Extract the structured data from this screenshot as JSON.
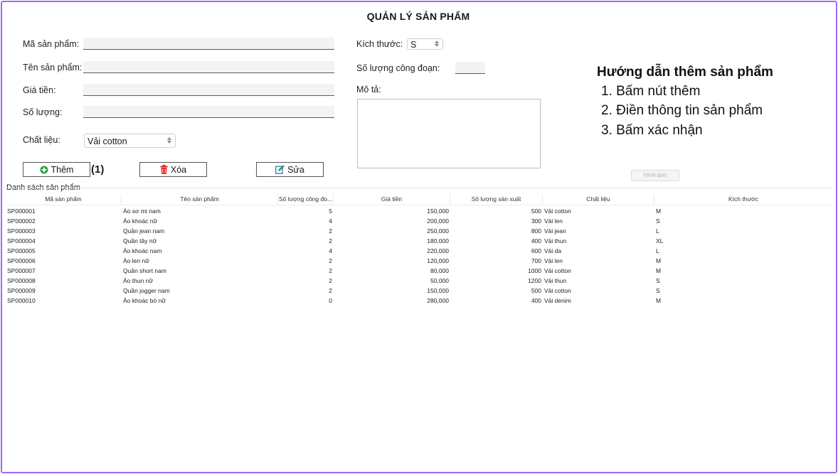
{
  "title": "QUẢN LÝ SẢN PHẨM",
  "form": {
    "ma_label": "Mã sản phẩm:",
    "ten_label": "Tên sản phẩm:",
    "gia_label": "Giá tiền:",
    "soluong_label": "Số lượng:",
    "chatlieu_label": "Chất liệu:",
    "chatlieu_value": "Vải cotton",
    "kichthuoc_label": "Kích thước:",
    "kichthuoc_value": "S",
    "congdoan_label": "Số lượng công đoạn:",
    "mota_label": "Mô tả:"
  },
  "buttons": {
    "them": "Thêm",
    "them_annotation": "(1)",
    "xoa": "Xóa",
    "sua": "Sửa",
    "hinh_anh": "Hình ảnh"
  },
  "guide": {
    "title": "Hướng dẫn thêm sản phẩm",
    "steps": [
      "1. Bấm nút thêm",
      "2. Điền thông tin sản phẩm",
      "3. Bấm xác nhận"
    ]
  },
  "table": {
    "caption": "Danh sách sản phẩm",
    "headers": [
      "Mã sản phẩm",
      "Tên sản phẩm",
      "Số lượng công đo...",
      "Giá tiền",
      "Số lượng sản xuất",
      "Chất liệu",
      "Kích thước"
    ],
    "rows": [
      [
        "SP000001",
        "Áo sơ mi nam",
        "5",
        "150,000",
        "500",
        "Vải cotton",
        "M"
      ],
      [
        "SP000002",
        "Áo khoác nữ",
        "4",
        "200,000",
        "300",
        "Vải len",
        "S"
      ],
      [
        "SP000003",
        "Quần jean nam",
        "2",
        "250,000",
        "800",
        "Vải jean",
        "L"
      ],
      [
        "SP000004",
        "Quần tây nữ",
        "2",
        "180,000",
        "400",
        "Vải thun",
        "XL"
      ],
      [
        "SP000005",
        "Áo khoác nam",
        "4",
        "220,000",
        "600",
        "Vải da",
        "L"
      ],
      [
        "SP000006",
        "Áo len nữ",
        "2",
        "120,000",
        "700",
        "Vải len",
        "M"
      ],
      [
        "SP000007",
        "Quần short nam",
        "2",
        "80,000",
        "1000",
        "Vải cotton",
        "M"
      ],
      [
        "SP000008",
        "Áo thun nữ",
        "2",
        "50,000",
        "1200",
        "Vải thun",
        "S"
      ],
      [
        "SP000009",
        "Quần jogger nam",
        "2",
        "150,000",
        "500",
        "Vải cotton",
        "S"
      ],
      [
        "SP000010",
        "Áo khoác bò nữ",
        "0",
        "280,000",
        "400",
        "Vải denim",
        "M"
      ]
    ]
  },
  "colors": {
    "frame": "#a06bf0",
    "add_icon": "#2e9e44",
    "delete_icon": "#e02020",
    "edit_icon": "#2a7fbf"
  }
}
